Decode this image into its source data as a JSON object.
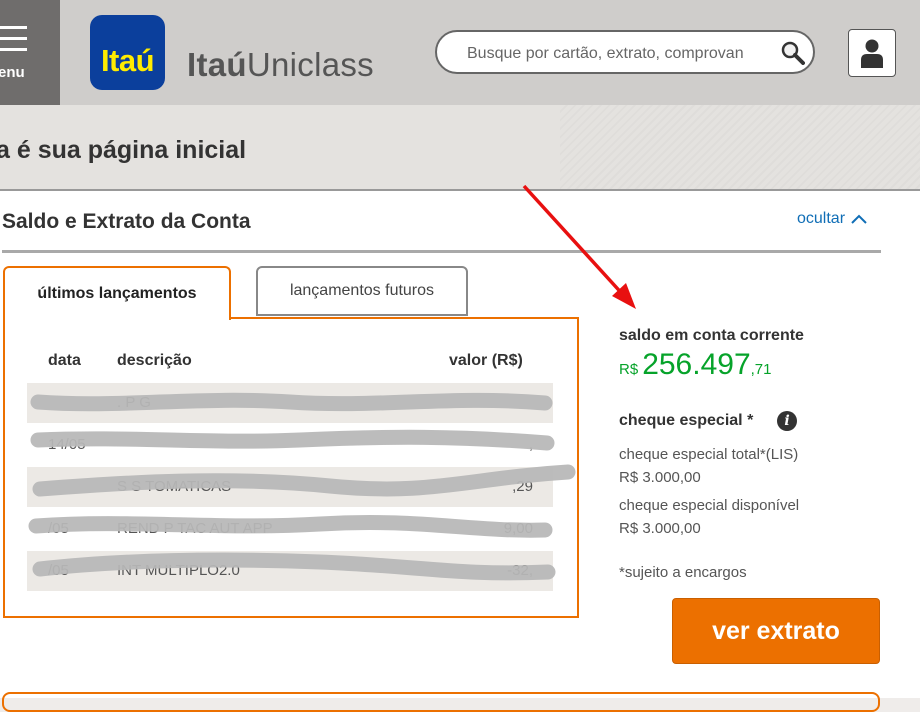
{
  "header": {
    "menu_label": "enu",
    "logo_text": "Itaú",
    "brand_bold": "Itaú",
    "brand_regular": "Uniclass",
    "search_placeholder": "Busque por cartão, extrato, comprovan",
    "colors": {
      "header_bg": "#cfcdcb",
      "menu_bg": "#6f6d6c",
      "logo_bg": "#0b3f9c",
      "logo_text": "#ffec00"
    }
  },
  "page": {
    "title": "a é sua página inicial"
  },
  "section": {
    "title": "Saldo e Extrato da Conta",
    "hide_label": "ocultar",
    "tabs": [
      {
        "label": "últimos lançamentos",
        "active": true
      },
      {
        "label": "lançamentos futuros",
        "active": false
      }
    ],
    "table": {
      "columns": [
        "data",
        "descrição",
        "valor (R$)"
      ],
      "rows": [
        {
          "date": "",
          "description": "  . P G",
          "value": ""
        },
        {
          "date": "14/05",
          "description": "",
          "value": ","
        },
        {
          "date": "",
          "description": "  S  S  TOMATICAS",
          "value": "  ,29"
        },
        {
          "date": "  /05",
          "description": "REND  P  TAC AUT APP",
          "value": "  9,00"
        },
        {
          "date": "  /05",
          "description": "INT MULTIPLO2.0",
          "value": "  -32,  "
        }
      ]
    }
  },
  "account": {
    "balance_label": "saldo em conta corrente",
    "currency": "R$",
    "balance_integer": "256.497",
    "balance_cents": ",71",
    "overdraft_label": "cheque especial *",
    "overdraft_total_label": "cheque especial total*(LIS)",
    "overdraft_total_value": "R$ 3.000,00",
    "overdraft_available_label": "cheque especial disponível",
    "overdraft_available_value": "R$ 3.000,00",
    "footnote": "*sujeito a encargos",
    "statement_button": "ver extrato",
    "colors": {
      "balance": "#06a32a",
      "accent": "#ec7000",
      "link": "#106eb6"
    }
  }
}
